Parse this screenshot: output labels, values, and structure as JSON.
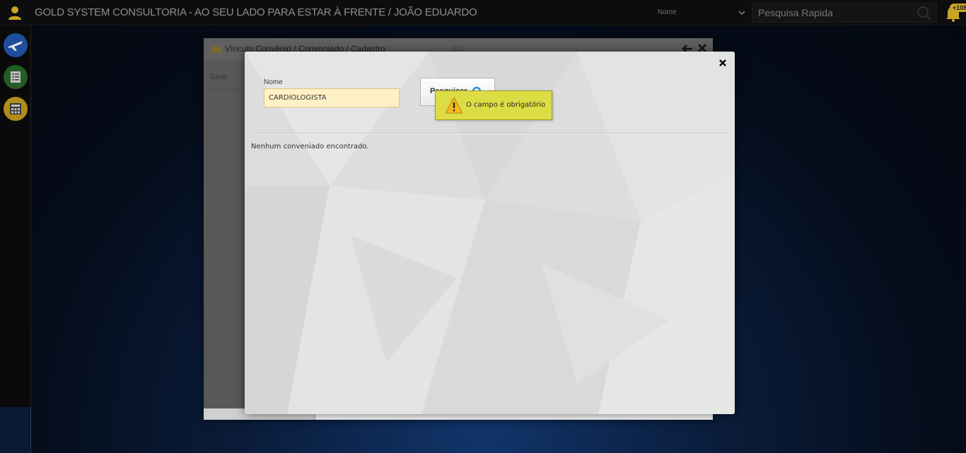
{
  "header": {
    "app_title": "GOLD SYSTEM CONSULTORIA - AO SEU LADO PARA ESTAR À FRENTE / JOÃO EDUARDO",
    "filter_value": "Nome",
    "quick_search_placeholder": "Pesquisa Rapida",
    "notifications_count": "+108"
  },
  "sidebar": {
    "items": [
      {
        "icon": "plane-icon",
        "color": "#2b6cd4"
      },
      {
        "icon": "document-list-icon",
        "color": "#2f7d2f"
      },
      {
        "icon": "calculator-icon",
        "color": "#c9a527"
      }
    ]
  },
  "back_window": {
    "title": "Vínculo Convênio / Conveniado / Cadastro",
    "tab_label": "Geral"
  },
  "dialog": {
    "nome_label": "Nome",
    "nome_value": "CARDIOLOGISTA",
    "search_button_label": "Pesquisar",
    "validation_message": "O campo é obrigatório",
    "empty_result_message": "Nenhum conveniado encontrado."
  },
  "colors": {
    "tooltip_bg": "#dcdc44",
    "input_bg": "#fff1c6",
    "accent_gold": "#c9a527"
  }
}
